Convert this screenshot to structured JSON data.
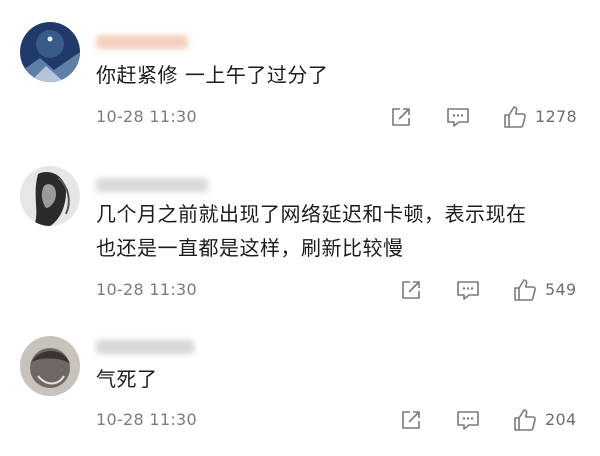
{
  "comments": [
    {
      "text_lines": [
        "你赶紧修 一上午了过分了"
      ],
      "time": "10-28 11:30",
      "likes": "1278",
      "name_blur_color": "#f3c6b2"
    },
    {
      "text_lines": [
        "几个月之前就出现了网络延迟和卡顿，表示现在",
        "也还是一直都是这样，刷新比较慢"
      ],
      "time": "10-28 11:30",
      "likes": "549",
      "name_blur_color": "#d2d2d2"
    },
    {
      "text_lines": [
        "气死了"
      ],
      "time": "10-28 11:30",
      "likes": "204",
      "name_blur_color": "#cfcfcf"
    }
  ],
  "icons": {
    "share": "share-icon",
    "reply": "comment-icon",
    "like": "thumbs-up-icon"
  },
  "colors": {
    "meta_text": "#7b7b7b",
    "icon_stroke": "#7a7a7a",
    "body_text": "#1c1c1c"
  }
}
